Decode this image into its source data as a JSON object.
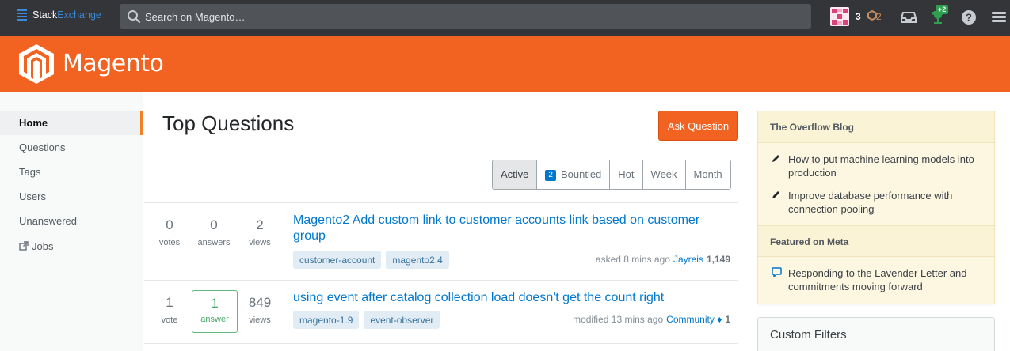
{
  "topbar": {
    "brand_bold": "Stack",
    "brand_color": "Exchange",
    "search_placeholder": "Search on Magento…",
    "reputation": "3",
    "bronze_count": "2",
    "achievement_badge": "+2",
    "icons": [
      "search-icon",
      "inbox-icon",
      "trophy-icon",
      "help-icon",
      "site-switcher-icon"
    ]
  },
  "header": {
    "site_name": "Magento",
    "accent": "#f26322"
  },
  "nav": {
    "items": [
      {
        "label": "Home",
        "active": true
      },
      {
        "label": "Questions"
      },
      {
        "label": "Tags"
      },
      {
        "label": "Users"
      },
      {
        "label": "Unanswered"
      },
      {
        "label": "Jobs",
        "icon": "external-link-icon"
      }
    ]
  },
  "main": {
    "title": "Top Questions",
    "ask_button": "Ask Question",
    "filters": {
      "active": "Active",
      "bountied_count": "2",
      "bountied": "Bountied",
      "hot": "Hot",
      "week": "Week",
      "month": "Month"
    },
    "questions": [
      {
        "votes": "0",
        "votes_label": "votes",
        "answers": "0",
        "answers_label": "answers",
        "views": "2",
        "views_label": "views",
        "title": "Magento2 Add custom link to customer accounts link based on customer group",
        "tags": [
          "customer-account",
          "magento2.4"
        ],
        "action": "asked 8 mins ago",
        "user": "Jayreis",
        "user_rep": "1,149"
      },
      {
        "votes": "1",
        "votes_label": "vote",
        "answers": "1",
        "answers_label": "answer",
        "views": "849",
        "views_label": "views",
        "title": "using event after catalog collection load doesn't get the count right",
        "tags": [
          "magento-1.9",
          "event-observer"
        ],
        "action": "modified 13 mins ago",
        "user": "Community",
        "user_mod": "♦",
        "user_rep": "1"
      }
    ]
  },
  "sidebar": {
    "blog_heading": "The Overflow Blog",
    "blog_items": [
      "How to put machine learning models into production",
      "Improve database performance with connection pooling"
    ],
    "meta_heading": "Featured on Meta",
    "meta_items": [
      "Responding to the Lavender Letter and commitments moving forward"
    ],
    "custom_filters_heading": "Custom Filters"
  }
}
